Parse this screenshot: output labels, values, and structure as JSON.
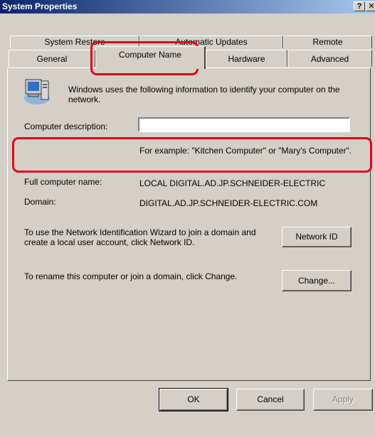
{
  "window": {
    "title": "System Properties",
    "help_glyph": "?",
    "close_glyph": "✕"
  },
  "tabs": {
    "row1": [
      {
        "label": "System Restore"
      },
      {
        "label": "Automatic Updates"
      },
      {
        "label": "Remote"
      }
    ],
    "row2": [
      {
        "label": "General"
      },
      {
        "label": "Computer Name",
        "active": true
      },
      {
        "label": "Hardware"
      },
      {
        "label": "Advanced"
      }
    ]
  },
  "panel": {
    "icon": "computer-network-icon",
    "intro": "Windows uses the following information to identify your computer on the network.",
    "description_label": "Computer description:",
    "description_value": "",
    "example": "For example: \"Kitchen Computer\" or \"Mary's Computer\".",
    "full_name_label": "Full computer name:",
    "full_name_value": "LOCAL DIGITAL.AD.JP.SCHNEIDER-ELECTRIC",
    "domain_label": "Domain:",
    "domain_value": "DIGITAL.AD.JP.SCHNEIDER-ELECTRIC.COM",
    "network_id_text": "To use the Network Identification Wizard to join a domain and create a local user account, click Network ID.",
    "network_id_button": "Network ID",
    "change_text": "To rename this computer or join a domain, click Change.",
    "change_button": "Change..."
  },
  "footer": {
    "ok": "OK",
    "cancel": "Cancel",
    "apply": "Apply"
  },
  "colors": {
    "dialog_bg": "#d4d0c8",
    "titlebar": "#0a246a",
    "highlight": "#e2001a"
  }
}
